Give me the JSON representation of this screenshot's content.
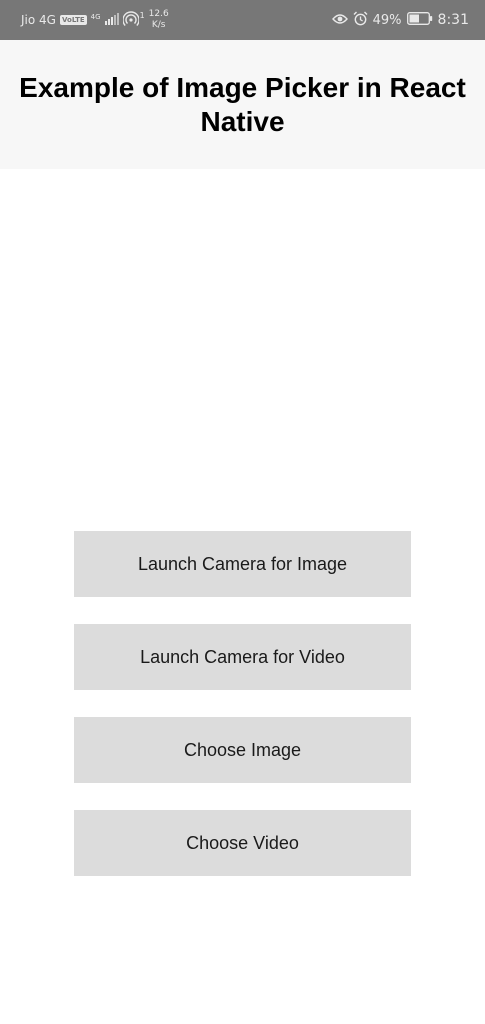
{
  "status_bar": {
    "carrier": "Jio 4G",
    "volte_badge": "VoLTE",
    "network_type": "4G",
    "notification_count": "1",
    "speed_value": "12.6",
    "speed_unit": "K/s",
    "battery_percent": "49%",
    "time": "8:31",
    "icons": [
      "signal-icon",
      "hotspot-icon",
      "eye-icon",
      "alarm-icon",
      "battery-icon"
    ]
  },
  "header": {
    "title": "Example of Image Picker in React Native"
  },
  "buttons": [
    {
      "label": "Launch Camera for Image"
    },
    {
      "label": "Launch Camera for Video"
    },
    {
      "label": "Choose Image"
    },
    {
      "label": "Choose Video"
    }
  ],
  "colors": {
    "status_bar_bg": "#777777",
    "header_bg": "#f7f7f7",
    "button_bg": "#dcdcdc"
  }
}
